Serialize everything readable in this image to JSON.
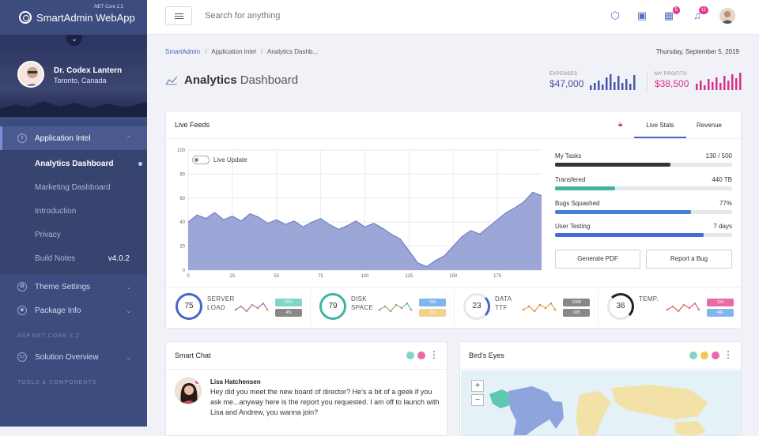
{
  "sidebar": {
    "brand": "SmartAdmin WebApp",
    "brand_sub": ".NET Core 2.2",
    "user_name": "Dr. Codex Lantern",
    "user_location": "Toronto, Canada",
    "nav": [
      {
        "label": "Application Intel",
        "icon": "info-icon"
      },
      {
        "label": "Theme Settings",
        "icon": "settings-icon"
      },
      {
        "label": "Package Info",
        "icon": "tag-icon"
      }
    ],
    "subitems": [
      {
        "label": "Analytics Dashboard"
      },
      {
        "label": "Marketing Dashboard"
      },
      {
        "label": "Introduction"
      },
      {
        "label": "Privacy"
      },
      {
        "label": "Build Notes",
        "version": "v4.0.2"
      }
    ],
    "section1": "ASP.NET CORE 2.2",
    "section1_item": "Solution Overview",
    "section2": "TOOLS & COMPONENTS"
  },
  "topbar": {
    "search_placeholder": "Search for anything",
    "badge_apps": "5",
    "badge_notifications": "11"
  },
  "breadcrumb": [
    "SmartAdmin",
    "Application Intel",
    "Analytics Dashb..."
  ],
  "breadcrumb_sep": "/",
  "date": "Thursday, September 5, 2019",
  "page_title_bold": "Analytics",
  "page_title_light": "Dashboard",
  "stats": {
    "expenses_label": "EXPENSES",
    "expenses_value": "$47,000",
    "expenses_color": "#4a55a8",
    "profits_label": "MY PROFITS",
    "profits_value": "$38,500",
    "profits_color": "#d6308a"
  },
  "live_feeds": {
    "title": "Live Feeds",
    "tabs": [
      "Live Stats",
      "Revenue"
    ],
    "toggle_label": "Live Update",
    "progress": [
      {
        "label": "My Tasks",
        "value": "130 / 500",
        "fraction": 0.65,
        "color": "#333333"
      },
      {
        "label": "Transfered",
        "value": "440 TB",
        "fraction": 0.34,
        "color": "#3fb3a3"
      },
      {
        "label": "Bugs Squashed",
        "value": "77%",
        "fraction": 0.77,
        "color": "#4a7fd6"
      },
      {
        "label": "User Testing",
        "value": "7 days",
        "fraction": 0.84,
        "color": "#4a6ad6"
      }
    ],
    "buttons": [
      "Generate PDF",
      "Report a Bug"
    ]
  },
  "chart_data": {
    "type": "area",
    "x_ticks": [
      "0",
      "25",
      "50",
      "75",
      "100",
      "125",
      "150",
      "175"
    ],
    "y_ticks": [
      "0",
      "20",
      "40",
      "60",
      "80",
      "100"
    ],
    "xlim": [
      0,
      200
    ],
    "ylim": [
      0,
      100
    ],
    "grid": true,
    "fill_color": "#8b98d1",
    "x": [
      0,
      5,
      10,
      15,
      20,
      25,
      30,
      35,
      40,
      45,
      50,
      55,
      60,
      65,
      70,
      75,
      80,
      85,
      90,
      95,
      100,
      105,
      110,
      115,
      120,
      125,
      130,
      135,
      140,
      145,
      150,
      155,
      160,
      165,
      170,
      175,
      180,
      185,
      190,
      195,
      200
    ],
    "values": [
      40,
      46,
      43,
      48,
      42,
      45,
      41,
      47,
      44,
      39,
      42,
      38,
      41,
      36,
      40,
      43,
      38,
      34,
      37,
      41,
      36,
      39,
      35,
      30,
      26,
      16,
      6,
      3,
      8,
      12,
      20,
      28,
      33,
      30,
      36,
      42,
      48,
      52,
      57,
      65,
      62
    ]
  },
  "kpis": [
    {
      "value": "75",
      "label1": "SERVER",
      "label2": "LOAD",
      "color": "#4a64c7",
      "pct": 0.75,
      "pill1": "52%",
      "pill2": "4%",
      "pill1_color": "#7fd6c8",
      "pill2_color": "#888888"
    },
    {
      "value": "79",
      "label1": "DISK",
      "label2": "SPACE",
      "color": "#3fb3a3",
      "pct": 0.79,
      "pill1": "76%",
      "pill2": "3%",
      "pill1_color": "#7fb6f0",
      "pill2_color": "#f2d28a"
    },
    {
      "value": "23",
      "label1": "DATA",
      "label2": "TTF",
      "color": "#4a64c7",
      "pct": 0.23,
      "pill1": "100B",
      "pill2": "10B",
      "pill1_color": "#888888",
      "pill2_color": "#888888"
    },
    {
      "value": "36",
      "label1": "TEMP.",
      "label2": "",
      "color": "#222222",
      "pct": 0.36,
      "pill1": "124",
      "pill2": "40F",
      "pill1_color": "#e86aa8",
      "pill2_color": "#7fb6f0"
    }
  ],
  "smart_chat": {
    "title": "Smart Chat",
    "name": "Lisa Hatchensen",
    "message": "Hey did you meet the new board of director? He's a bit of a geek if you ask me...anyway here is the report you requested. I am off to launch with Lisa and Andrew, you wanna join?"
  },
  "birds_eye": {
    "title": "Bird's Eyes",
    "zoom_in": "+",
    "zoom_out": "−"
  }
}
